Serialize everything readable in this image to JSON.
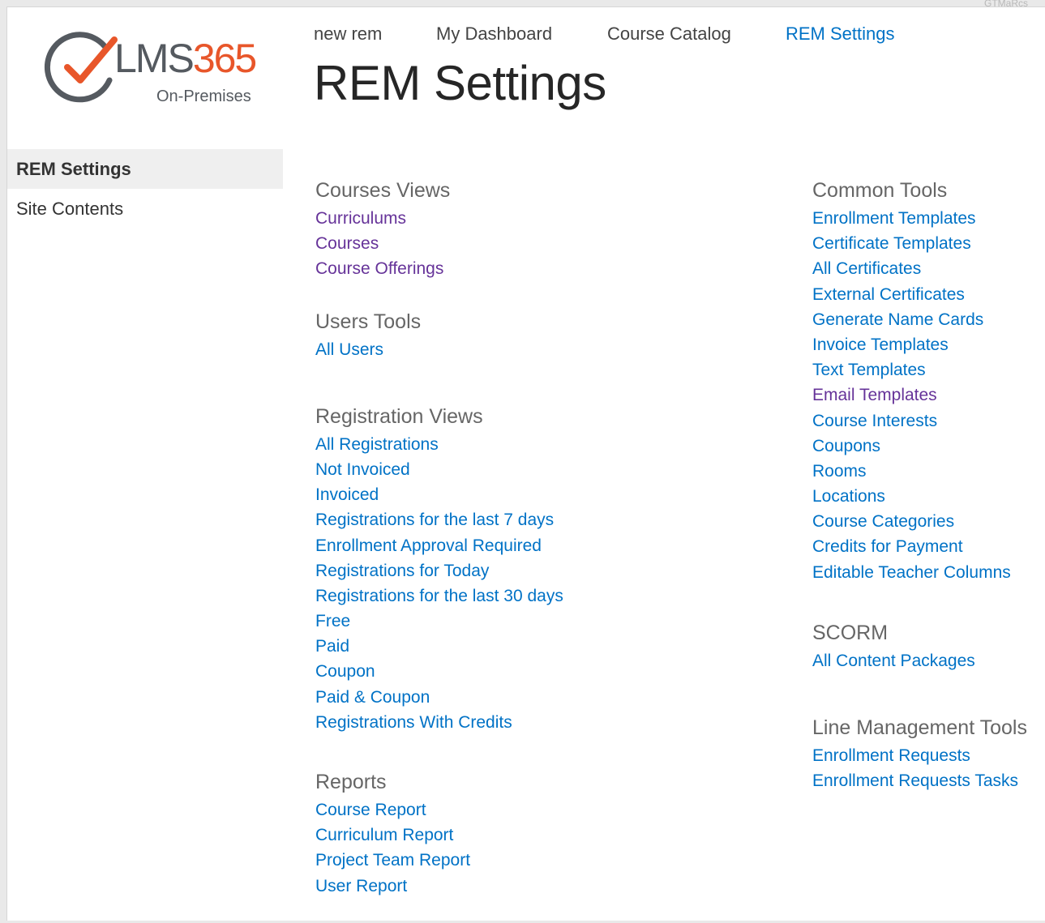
{
  "corner_label": "GTMaRcs",
  "logo": {
    "brand_prefix": "LMS",
    "brand_number": "365",
    "subtitle": "On-Premises",
    "accent_color": "#e8562a",
    "text_color": "#555a60"
  },
  "top_nav": [
    {
      "label": "new rem"
    },
    {
      "label": "My Dashboard"
    },
    {
      "label": "Course Catalog"
    },
    {
      "label": "REM Settings",
      "active": true
    }
  ],
  "page_title": "REM Settings",
  "left_nav": [
    {
      "label": "REM Settings",
      "selected": true
    },
    {
      "label": "Site Contents"
    }
  ],
  "colors": {
    "link": "#0072c6",
    "visited_link": "#663399",
    "group_title": "#666666"
  },
  "groups_left": [
    {
      "title": "Courses Views",
      "links": [
        {
          "label": "Curriculums",
          "visited": true
        },
        {
          "label": "Courses",
          "visited": true
        },
        {
          "label": "Course Offerings",
          "visited": true
        }
      ]
    },
    {
      "title": "Users Tools",
      "links": [
        {
          "label": "All Users"
        }
      ]
    },
    {
      "title": "Registration Views",
      "links": [
        {
          "label": "All Registrations"
        },
        {
          "label": "Not Invoiced"
        },
        {
          "label": "Invoiced"
        },
        {
          "label": "Registrations for the last 7 days"
        },
        {
          "label": "Enrollment Approval Required"
        },
        {
          "label": "Registrations for Today"
        },
        {
          "label": "Registrations for the last 30 days"
        },
        {
          "label": "Free"
        },
        {
          "label": "Paid"
        },
        {
          "label": "Coupon"
        },
        {
          "label": "Paid & Coupon"
        },
        {
          "label": "Registrations With Credits"
        }
      ]
    },
    {
      "title": "Reports",
      "links": [
        {
          "label": "Course Report"
        },
        {
          "label": "Curriculum Report"
        },
        {
          "label": "Project Team Report"
        },
        {
          "label": "User Report"
        }
      ]
    }
  ],
  "groups_right": [
    {
      "title": "Common Tools",
      "links": [
        {
          "label": "Enrollment Templates"
        },
        {
          "label": "Certificate Templates"
        },
        {
          "label": "All Certificates"
        },
        {
          "label": "External Certificates"
        },
        {
          "label": "Generate Name Cards"
        },
        {
          "label": "Invoice Templates"
        },
        {
          "label": "Text Templates"
        },
        {
          "label": "Email Templates",
          "visited": true
        },
        {
          "label": "Course Interests"
        },
        {
          "label": "Coupons"
        },
        {
          "label": "Rooms"
        },
        {
          "label": "Locations"
        },
        {
          "label": "Course Categories"
        },
        {
          "label": "Credits for Payment"
        },
        {
          "label": "Editable Teacher Columns"
        }
      ]
    },
    {
      "title": "SCORM",
      "links": [
        {
          "label": "All Content Packages"
        }
      ]
    },
    {
      "title": "Line Management Tools",
      "links": [
        {
          "label": "Enrollment Requests"
        },
        {
          "label": "Enrollment Requests Tasks"
        }
      ]
    }
  ]
}
